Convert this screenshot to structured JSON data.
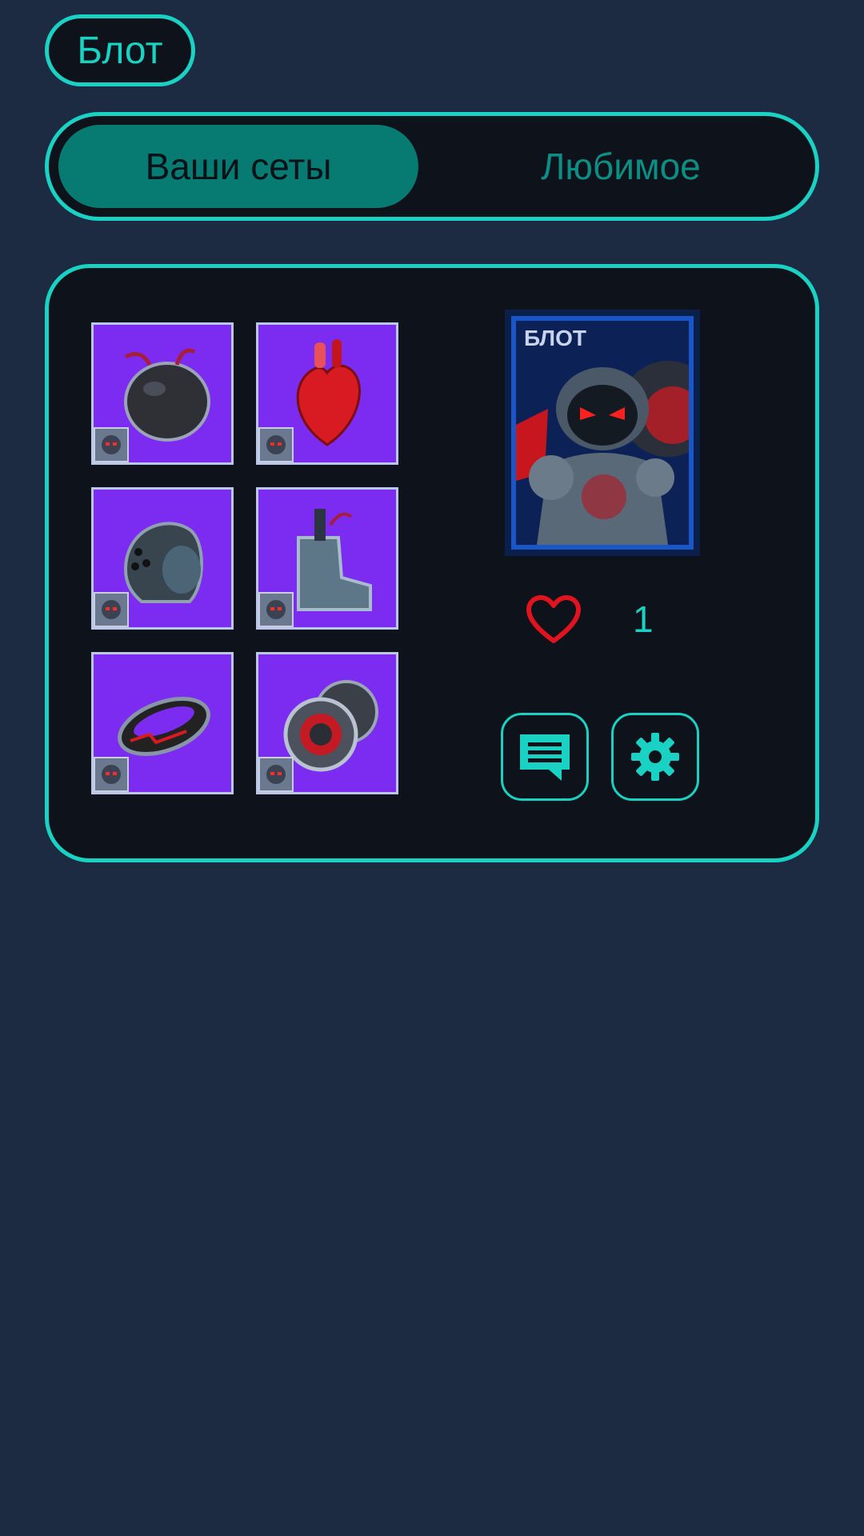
{
  "header": {
    "title_chip": "Блот"
  },
  "tabs": [
    {
      "label": "Ваши сеты",
      "active": true
    },
    {
      "label": "Любимое",
      "active": false
    }
  ],
  "set_card": {
    "items": [
      {
        "icon": "bomb-ball-icon"
      },
      {
        "icon": "heart-organ-icon"
      },
      {
        "icon": "helmet-icon"
      },
      {
        "icon": "boot-icon"
      },
      {
        "icon": "ring-bracer-icon"
      },
      {
        "icon": "speaker-discs-icon"
      }
    ],
    "portrait": {
      "name": "БЛОТ"
    },
    "likes": {
      "count": "1"
    },
    "actions": [
      {
        "icon": "comment-icon"
      },
      {
        "icon": "gear-icon"
      }
    ]
  },
  "colors": {
    "background": "#1c2a42",
    "accent": "#19d2c3",
    "panel": "#0e121a",
    "active_tab": "#077a71",
    "item_bg": "#7b2cf0",
    "heart": "#e0141e"
  }
}
